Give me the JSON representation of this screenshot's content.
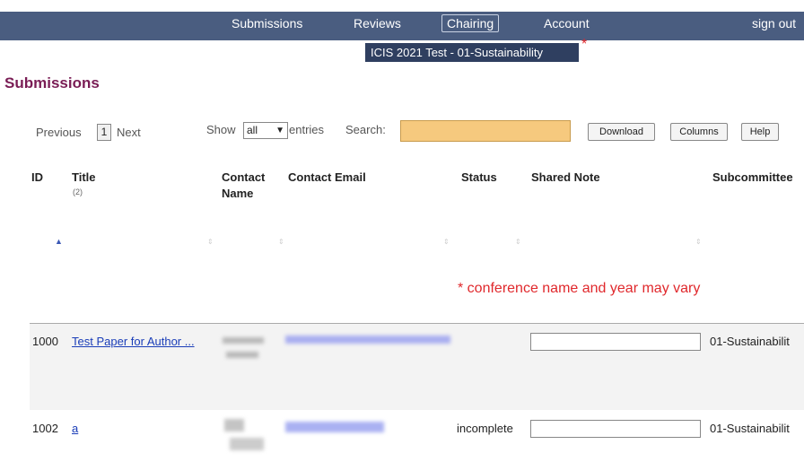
{
  "nav": {
    "items": [
      {
        "label": "Submissions"
      },
      {
        "label": "Reviews"
      },
      {
        "label": "Chairing"
      },
      {
        "label": "Account"
      }
    ],
    "sign_out": "sign out"
  },
  "conference": {
    "name": "ICIS 2021 Test - 01-Sustainability",
    "asterisk": "*"
  },
  "page_title": "Submissions",
  "paging": {
    "previous": "Previous",
    "current_page": "1",
    "next": "Next"
  },
  "show": {
    "label_before": "Show",
    "selected": "all",
    "label_after": "entries"
  },
  "search": {
    "label": "Search:",
    "placeholder": ""
  },
  "buttons": {
    "download": "Download",
    "columns": "Columns",
    "help": "Help"
  },
  "columns": {
    "id": "ID",
    "title": "Title",
    "title_count": "(2)",
    "contact_name_1": "Contact",
    "contact_name_2": "Name",
    "contact_email": "Contact Email",
    "status": "Status",
    "shared_note": "Shared Note",
    "subcommittee": "Subcommittee"
  },
  "annotation": "* conference name and year may vary",
  "rows": [
    {
      "id": "1000",
      "title": "Test Paper for Author ...",
      "status": "",
      "subcommittee": "01-Sustainabilit"
    },
    {
      "id": "1002",
      "title": "a",
      "status": "incomplete",
      "subcommittee": "01-Sustainabilit"
    }
  ],
  "colors": {
    "nav_bg": "#4a5d80",
    "conf_bg": "#2f3f60",
    "title": "#7a1d55",
    "search_bg": "#f6c97e",
    "annotation": "#e0282c",
    "link": "#1a3db8"
  }
}
